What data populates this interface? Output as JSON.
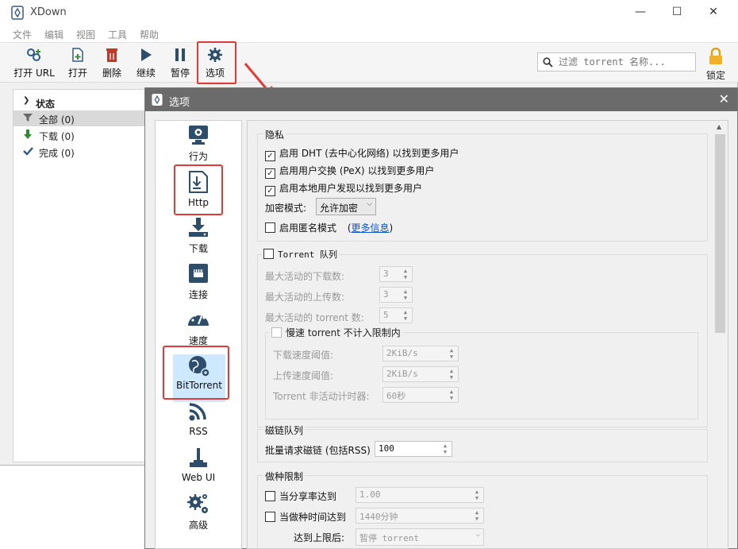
{
  "app": {
    "title": "XDown"
  },
  "window_controls": {
    "minimize": "—",
    "maximize": "☐",
    "close": "✕"
  },
  "menu": [
    "文件",
    "编辑",
    "视图",
    "工具",
    "帮助"
  ],
  "toolbar": {
    "open_url": "打开 URL",
    "open": "打开",
    "delete": "删除",
    "resume": "继续",
    "pause": "暂停",
    "options": "选项",
    "lock": "锁定"
  },
  "search": {
    "placeholder": "过滤 torrent 名称..."
  },
  "sidebar": {
    "header": "状态",
    "items": [
      {
        "label": "全部 (0)",
        "icon": "filter-icon"
      },
      {
        "label": "下载 (0)",
        "icon": "download-arrow-icon"
      },
      {
        "label": "完成 (0)",
        "icon": "checkmark-icon"
      }
    ]
  },
  "dialog": {
    "title": "选项",
    "close": "✕",
    "categories": [
      {
        "label": "行为",
        "icon": "monitor-gear-icon"
      },
      {
        "label": "Http",
        "icon": "http-download-icon"
      },
      {
        "label": "下载",
        "icon": "download-tray-icon"
      },
      {
        "label": "连接",
        "icon": "ethernet-icon"
      },
      {
        "label": "速度",
        "icon": "speedometer-icon"
      },
      {
        "label": "BitTorrent",
        "icon": "globe-gear-icon"
      },
      {
        "label": "RSS",
        "icon": "rss-icon"
      },
      {
        "label": "Web UI",
        "icon": "joystick-icon"
      },
      {
        "label": "高级",
        "icon": "gears-icon"
      }
    ]
  },
  "privacy": {
    "title": "隐私",
    "dht": "启用 DHT (去中心化网络) 以找到更多用户",
    "pex": "启用用户交换 (PeX) 以找到更多用户",
    "lsd": "启用本地用户发现以找到更多用户",
    "encryption_label": "加密模式:",
    "encryption_value": "允许加密",
    "anonymous": "启用匿名模式",
    "more_info_open": "(",
    "more_info": "更多信息",
    "more_info_close": ")"
  },
  "queue": {
    "title": "Torrent 队列",
    "max_downloads_label": "最大活动的下载数:",
    "max_downloads": "3",
    "max_uploads_label": "最大活动的上传数:",
    "max_uploads": "3",
    "max_torrents_label": "最大活动的 torrent 数:",
    "max_torrents": "5",
    "slow_title": "慢速 torrent 不计入限制内",
    "dl_threshold_label": "下载速度阈值:",
    "dl_threshold": "2KiB/s",
    "ul_threshold_label": "上传速度阈值:",
    "ul_threshold": "2KiB/s",
    "inactivity_label": "Torrent 非活动计时器:",
    "inactivity": "60秒"
  },
  "magnet": {
    "title": "磁链队列",
    "batch_label": "批量请求磁链 (包括RSS)",
    "batch_value": "100"
  },
  "seeding": {
    "title": "做种限制",
    "ratio_label": "当分享率达到",
    "ratio_value": "1.00",
    "time_label": "当做种时间达到",
    "time_value": "1440分钟",
    "action_label": "达到上限后:",
    "action_value": "暂停 torrent"
  },
  "colors": {
    "highlight": "#e03b3b",
    "selection": "#cde8ff",
    "accent": "#2b6cb0"
  }
}
